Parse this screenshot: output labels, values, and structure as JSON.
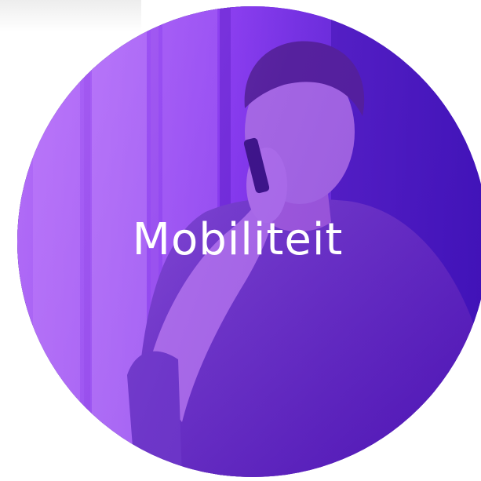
{
  "tile": {
    "label": "Mobiliteit",
    "overlay_color": "#7a2fe0",
    "text_color": "#ffffff"
  },
  "photo": {
    "subject": "man-on-phone-photo"
  }
}
